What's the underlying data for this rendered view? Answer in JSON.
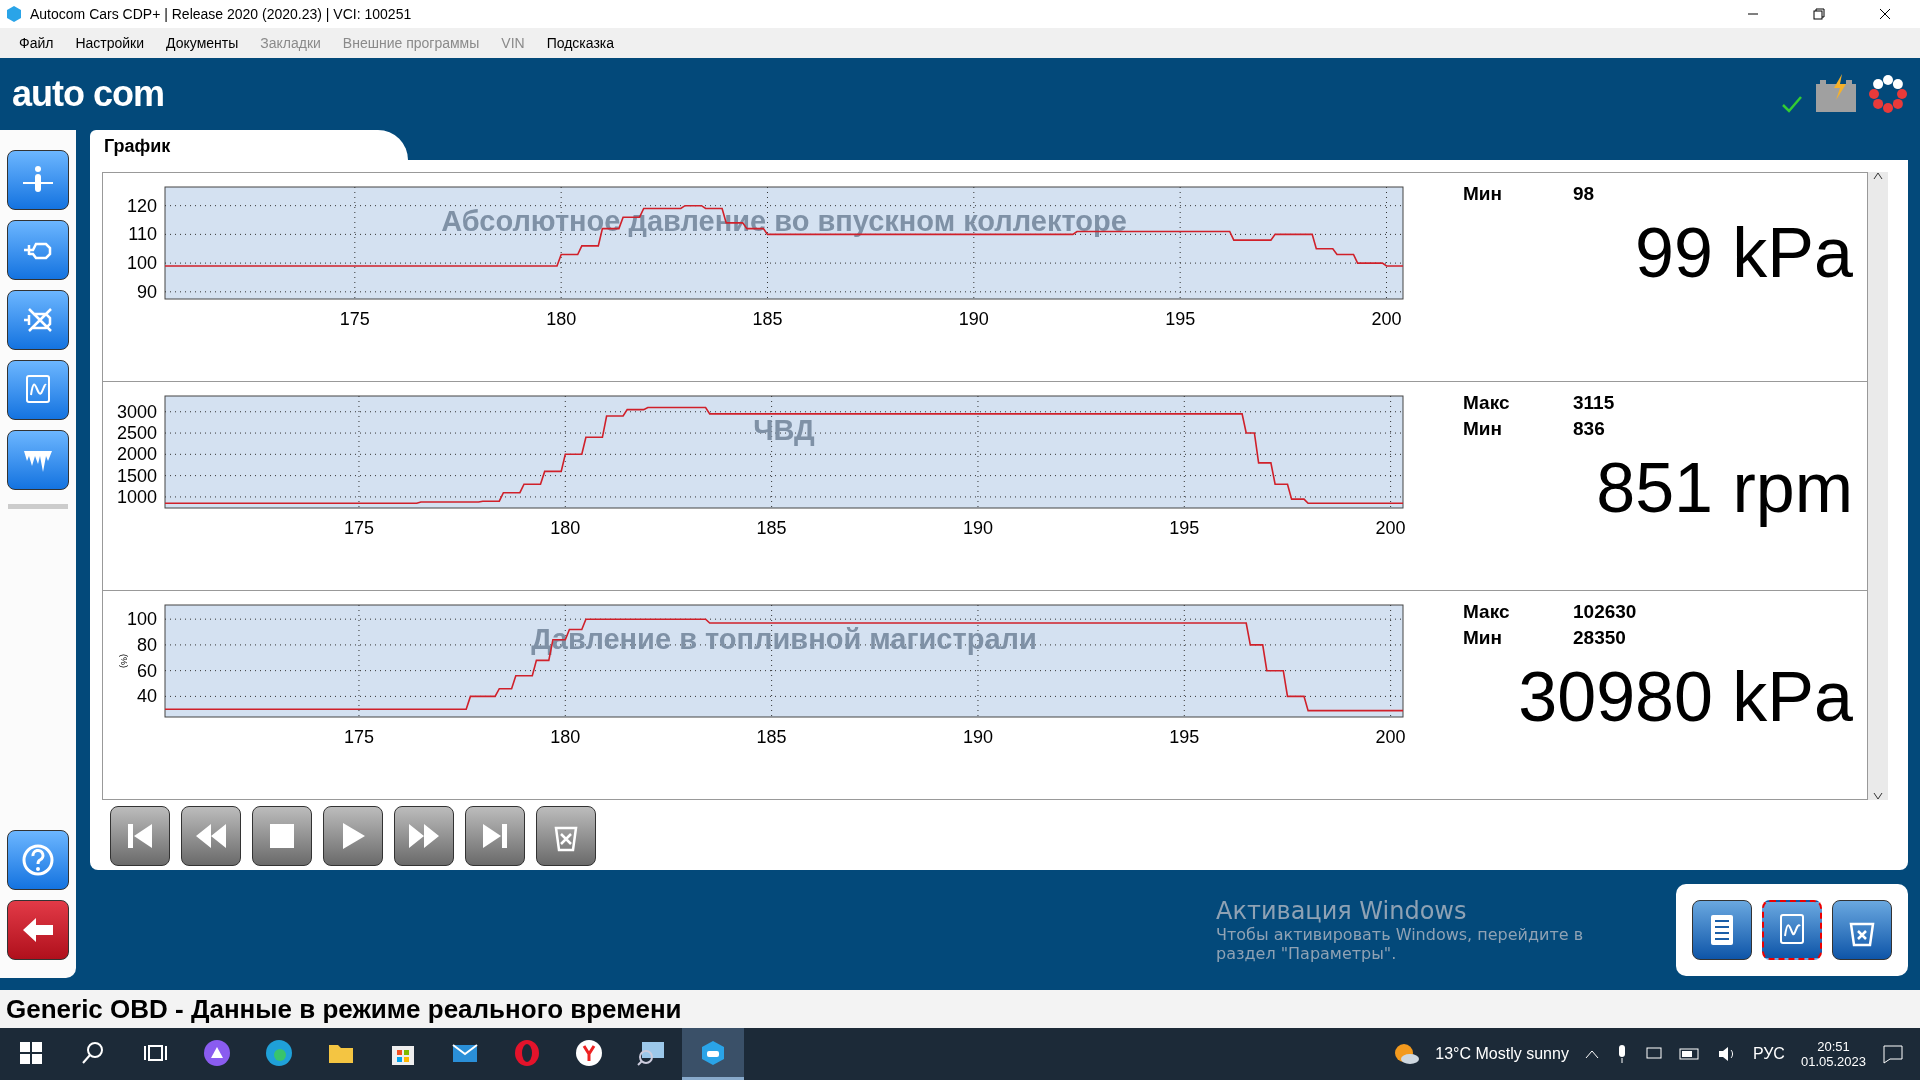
{
  "window": {
    "title": "Autocom Cars CDP+ |  Release 2020 (2020.23)  |  VCI: 100251"
  },
  "menu": [
    {
      "label": "Файл",
      "disabled": false
    },
    {
      "label": "Настройки",
      "disabled": false
    },
    {
      "label": "Документы",
      "disabled": false
    },
    {
      "label": "Закладки",
      "disabled": true
    },
    {
      "label": "Внешние программы",
      "disabled": true
    },
    {
      "label": "VIN",
      "disabled": true
    },
    {
      "label": "Подсказка",
      "disabled": false
    }
  ],
  "logo": "auto com",
  "sidebar": [
    {
      "kind": "info"
    },
    {
      "kind": "engine"
    },
    {
      "kind": "engine-off"
    },
    {
      "kind": "graph"
    },
    {
      "kind": "freeze"
    }
  ],
  "sidebar_bottom": [
    {
      "kind": "help"
    },
    {
      "kind": "back"
    }
  ],
  "tab": {
    "label": "График"
  },
  "graphs": [
    {
      "stats": [
        {
          "label": "Мин",
          "value": "98"
        }
      ],
      "reading": "99 kPa",
      "chart_data": {
        "type": "line",
        "title": "Абсолютное давление во впускном коллекторе",
        "xlim": [
          170.4,
          200.4
        ],
        "ylim": [
          87.5,
          126.5
        ],
        "xticks": [
          175,
          180,
          185,
          190,
          195,
          200
        ],
        "yticks": [
          90,
          100,
          110,
          120
        ],
        "grid": true,
        "x": [
          170.4,
          179.9,
          180,
          180.4,
          180.5,
          180.9,
          181,
          181.4,
          181.5,
          181.9,
          182,
          182.9,
          183,
          183.4,
          183.5,
          183.9,
          184,
          184.4,
          184.5,
          184.9,
          185,
          192.4,
          192.5,
          196.2,
          196.3,
          197.2,
          197.3,
          198.2,
          198.3,
          198.7,
          198.8,
          199.2,
          199.3,
          199.9,
          200,
          200.4
        ],
        "series": [
          {
            "color": "#d0202a",
            "values": [
              99,
              99,
              103,
              103,
              106,
              106,
              112,
              112,
              116,
              116,
              119,
              119,
              120,
              120,
              119,
              119,
              114,
              114,
              112,
              112,
              110,
              110,
              111,
              111,
              108,
              108,
              110,
              110,
              105,
              105,
              103,
              103,
              100,
              100,
              99,
              99
            ]
          }
        ]
      }
    },
    {
      "stats": [
        {
          "label": "Макс",
          "value": "3115"
        },
        {
          "label": "Мин",
          "value": "836"
        }
      ],
      "reading": "851 rpm",
      "chart_data": {
        "type": "line",
        "title": "ЧВД",
        "xlim": [
          170.3,
          200.3
        ],
        "ylim": [
          740,
          3370
        ],
        "xticks": [
          175,
          180,
          185,
          190,
          195,
          200
        ],
        "yticks": [
          1000,
          1500,
          2000,
          2500,
          3000
        ],
        "grid": true,
        "x": [
          170.3,
          176.4,
          176.5,
          177.9,
          178,
          178.4,
          178.5,
          178.9,
          179,
          179.4,
          179.5,
          179.9,
          180,
          180.4,
          180.5,
          180.9,
          181,
          181.4,
          181.5,
          181.9,
          182,
          183.4,
          183.5,
          196.4,
          196.5,
          196.7,
          196.8,
          197.1,
          197.2,
          197.5,
          197.6,
          197.9,
          198,
          200.3
        ],
        "series": [
          {
            "color": "#d0202a",
            "values": [
              850,
              850,
              880,
              880,
              900,
              900,
              1100,
              1100,
              1300,
              1300,
              1600,
              1600,
              2000,
              2000,
              2400,
              2400,
              2900,
              2900,
              3050,
              3050,
              3100,
              3100,
              2950,
              2950,
              2500,
              2500,
              1800,
              1800,
              1300,
              1300,
              950,
              950,
              850,
              850
            ]
          }
        ]
      }
    },
    {
      "stats": [
        {
          "label": "Макс",
          "value": "102630"
        },
        {
          "label": "Мин",
          "value": "28350"
        }
      ],
      "reading": "30980 kPa",
      "chart_data": {
        "type": "line",
        "title": "Давление в топливной магистрали",
        "ylabel": "(%)",
        "xlim": [
          170.3,
          200.3
        ],
        "ylim": [
          24,
          111
        ],
        "xticks": [
          175,
          180,
          185,
          190,
          195,
          200
        ],
        "yticks": [
          40,
          60,
          80,
          100
        ],
        "grid": true,
        "x": [
          170.3,
          177.6,
          177.7,
          178.3,
          178.4,
          178.7,
          178.8,
          179.2,
          179.3,
          179.6,
          179.7,
          180,
          180.1,
          180.4,
          180.5,
          183.4,
          183.5,
          196.5,
          196.6,
          196.9,
          197,
          197.4,
          197.5,
          197.9,
          198,
          200.3
        ],
        "series": [
          {
            "color": "#d0202a",
            "values": [
              30,
              30,
              40,
              40,
              46,
              46,
              56,
              56,
              68,
              68,
              84,
              84,
              92,
              92,
              100,
              100,
              97,
              97,
              80,
              80,
              60,
              60,
              40,
              40,
              29,
              29
            ]
          }
        ]
      }
    }
  ],
  "playback": [
    {
      "kind": "first"
    },
    {
      "kind": "rewind"
    },
    {
      "kind": "stop"
    },
    {
      "kind": "play"
    },
    {
      "kind": "forward"
    },
    {
      "kind": "last"
    },
    {
      "kind": "delete"
    }
  ],
  "activation": {
    "title": "Активация Windows",
    "text": "Чтобы активировать Windows, перейдите в раздел \"Параметры\"."
  },
  "view_buttons": [
    {
      "kind": "list",
      "selected": false
    },
    {
      "kind": "graph",
      "selected": true
    },
    {
      "kind": "delete",
      "selected": false
    }
  ],
  "status_bar": {
    "text": "Generic OBD - Данные в режиме реального времени"
  },
  "taskbar": {
    "apps": [
      {
        "kind": "search",
        "selected": false
      },
      {
        "kind": "taskview",
        "selected": false
      },
      {
        "kind": "circle",
        "selected": false
      },
      {
        "kind": "edge",
        "selected": false
      },
      {
        "kind": "folder",
        "selected": false
      },
      {
        "kind": "store",
        "selected": false
      },
      {
        "kind": "mail",
        "selected": false
      },
      {
        "kind": "opera",
        "selected": false
      },
      {
        "kind": "yandex",
        "selected": false
      },
      {
        "kind": "monitor",
        "selected": false
      },
      {
        "kind": "car",
        "selected": true
      }
    ],
    "weather": "13°C  Mostly sunny",
    "language": "РУС",
    "time": "20:51",
    "date": "01.05.2023"
  }
}
